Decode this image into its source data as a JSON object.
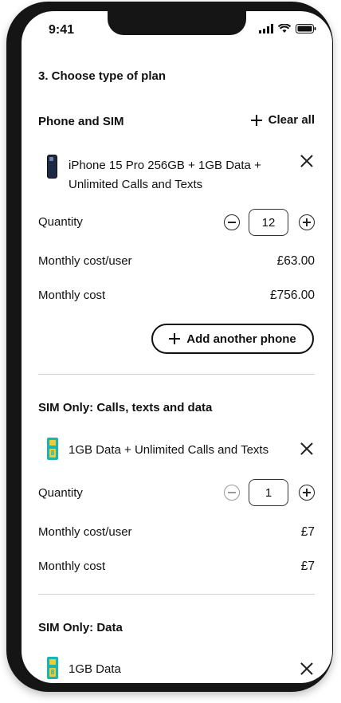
{
  "status_bar": {
    "time": "9:41"
  },
  "step_title": "3. Choose type of plan",
  "phone_section": {
    "title": "Phone and SIM",
    "clear_all_label": "Clear all",
    "item_line1": "iPhone 15 Pro 256GB + 1GB Data +",
    "item_line2": "Unlimited Calls and Texts",
    "quantity_label": "Quantity",
    "quantity_value": "12",
    "monthly_cost_user_label": "Monthly cost/user",
    "monthly_cost_user_value": "£63.00",
    "monthly_cost_label": "Monthly cost",
    "monthly_cost_value": "£756.00",
    "add_another_label": "Add another phone"
  },
  "sim_only_section": {
    "title": "SIM Only: Calls, texts and data",
    "item": "1GB Data + Unlimited Calls and Texts",
    "quantity_label": "Quantity",
    "quantity_value": "1",
    "monthly_cost_user_label": "Monthly cost/user",
    "monthly_cost_user_value": "£7",
    "monthly_cost_label": "Monthly cost",
    "monthly_cost_value": "£7"
  },
  "data_section": {
    "title": "SIM Only: Data",
    "item": "1GB Data"
  },
  "sim_card_text": "8",
  "icons": [
    "signal-icon",
    "wifi-icon",
    "battery-icon",
    "plus-icon",
    "close-icon",
    "minus-circle-icon",
    "plus-circle-icon",
    "iphone-icon",
    "sim-card-icon"
  ]
}
